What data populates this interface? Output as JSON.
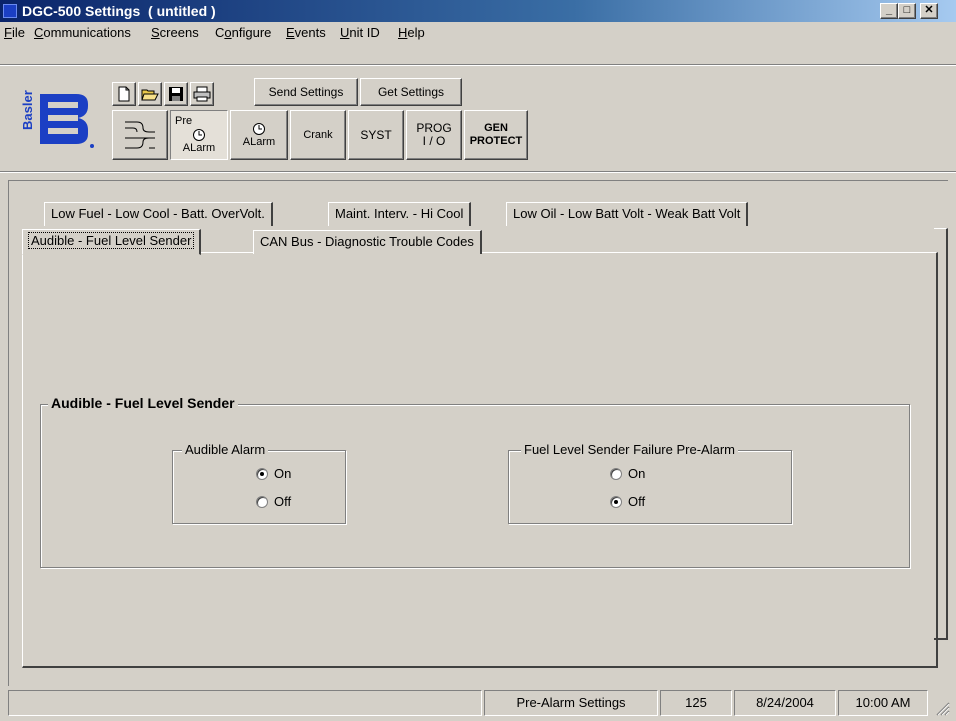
{
  "window": {
    "title": "DGC-500 Settings  ( untitled )"
  },
  "caption_buttons": {
    "minimize": "_",
    "maximize": "□",
    "close": "✕"
  },
  "menu": [
    {
      "label": "File",
      "accel": "F",
      "rest": "ile"
    },
    {
      "label": "Communications",
      "accel": "C",
      "rest": "ommunications"
    },
    {
      "label": "Screens",
      "accel": "S",
      "rest": "creens"
    },
    {
      "label": "Configure",
      "pre": "C",
      "accel": "o",
      "rest": "nfigure"
    },
    {
      "label": "Events",
      "accel": "E",
      "rest": "vents"
    },
    {
      "label": "Unit ID",
      "accel": "U",
      "rest": "nit ID"
    },
    {
      "label": "Help",
      "accel": "H",
      "rest": "elp"
    }
  ],
  "toolbar": {
    "logo_text": "Basler",
    "send_settings": "Send Settings",
    "get_settings": "Get Settings",
    "pre_alarm_top": "Pre",
    "pre_alarm_bottom": "ALarm",
    "alarm": "ALarm",
    "crank": "Crank",
    "syst": "SYST",
    "prog_top": "PROG",
    "prog_bottom": "I / O",
    "gen_top": "GEN",
    "gen_bottom": "PROTECT"
  },
  "tabs": {
    "row_back": [
      "Low Fuel - Low Cool - Batt. OverVolt.",
      "Maint. Interv. - Hi Cool",
      "Low Oil - Low Batt  Volt - Weak Batt Volt"
    ],
    "row_front": [
      "Audible -  Fuel Level Sender",
      "CAN Bus - Diagnostic Trouble Codes"
    ],
    "active": "Audible -  Fuel Level Sender"
  },
  "panel": {
    "group_title": "Audible - Fuel Level Sender",
    "audible_alarm": {
      "legend": "Audible Alarm",
      "on": "On",
      "off": "Off",
      "selected": "On"
    },
    "fuel_sender": {
      "legend": "Fuel Level Sender Failure Pre-Alarm",
      "on": "On",
      "off": "Off",
      "selected": "Off"
    }
  },
  "status": {
    "section": "Pre-Alarm Settings",
    "value": "125",
    "date": "8/24/2004",
    "time": "10:00 AM"
  },
  "colors": {
    "title_start": "#0a246a",
    "title_end": "#a6caf0",
    "face": "#d4d0c8",
    "logo": "#1b3fc4"
  }
}
